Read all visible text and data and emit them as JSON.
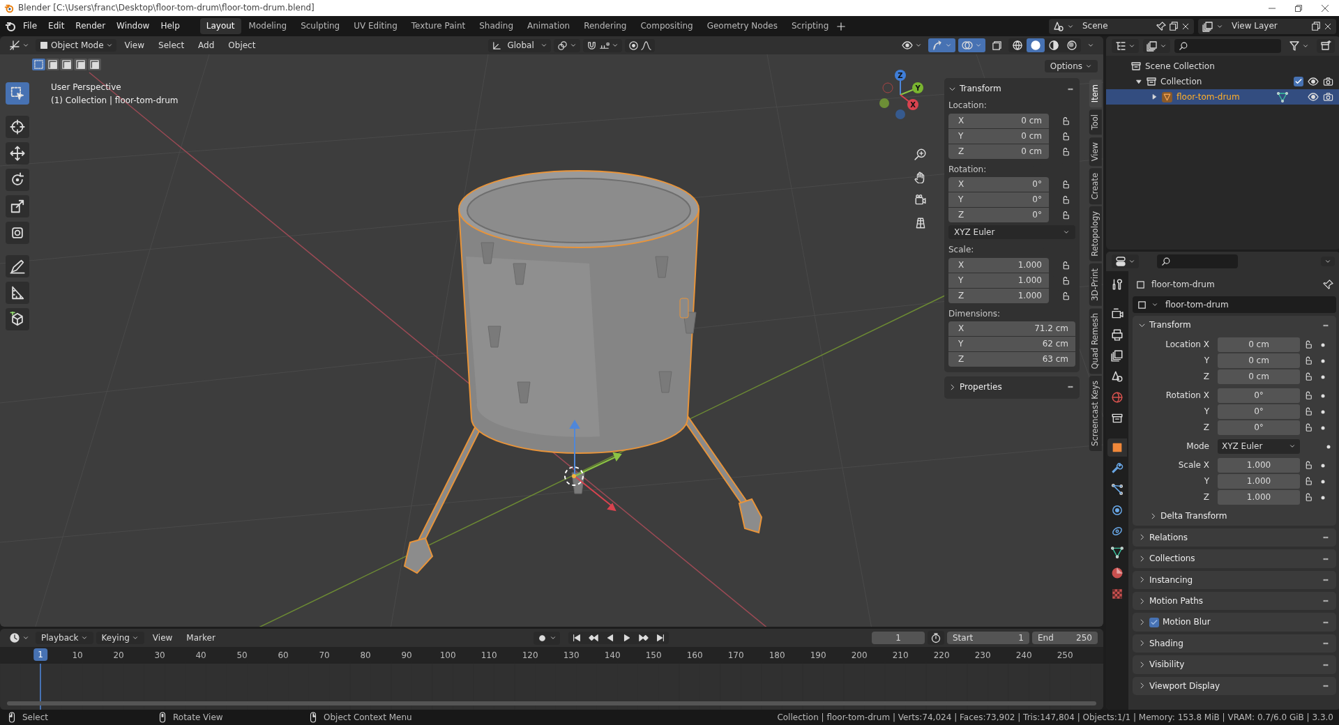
{
  "window": {
    "title": "Blender [C:\\Users\\franc\\Desktop\\floor-tom-drum\\floor-tom-drum.blend]"
  },
  "menu": [
    "File",
    "Edit",
    "Render",
    "Window",
    "Help"
  ],
  "workspaces": [
    {
      "label": "Layout",
      "selected": true
    },
    {
      "label": "Modeling",
      "selected": false
    },
    {
      "label": "Sculpting",
      "selected": false
    },
    {
      "label": "UV Editing",
      "selected": false
    },
    {
      "label": "Texture Paint",
      "selected": false
    },
    {
      "label": "Shading",
      "selected": false
    },
    {
      "label": "Animation",
      "selected": false
    },
    {
      "label": "Rendering",
      "selected": false
    },
    {
      "label": "Compositing",
      "selected": false
    },
    {
      "label": "Geometry Nodes",
      "selected": false
    },
    {
      "label": "Scripting",
      "selected": false
    }
  ],
  "scene": {
    "name": "Scene"
  },
  "view_layer": {
    "name": "View Layer"
  },
  "viewport_header": {
    "mode": "Object Mode",
    "menus": [
      "View",
      "Select",
      "Add",
      "Object"
    ],
    "orientation": "Global",
    "gizmos_on": true,
    "overlays_on": true,
    "shading": [
      {
        "kind": "wireframe",
        "selected": false
      },
      {
        "kind": "solid",
        "selected": true
      },
      {
        "kind": "material",
        "selected": false
      },
      {
        "kind": "rendered",
        "selected": false
      }
    ],
    "options": "Options"
  },
  "select_modes": [
    {
      "selected": true
    },
    {
      "selected": false
    },
    {
      "selected": false
    },
    {
      "selected": false
    },
    {
      "selected": false
    }
  ],
  "tools": [
    {
      "kind": "select",
      "selected": true
    },
    {
      "kind": "cursor",
      "selected": false
    },
    {
      "kind": "move",
      "selected": false
    },
    {
      "kind": "rotate",
      "selected": false
    },
    {
      "kind": "scale",
      "selected": false
    },
    {
      "kind": "transform",
      "selected": false
    },
    {
      "kind": "annotate",
      "selected": false
    },
    {
      "kind": "measure",
      "selected": false
    },
    {
      "kind": "add_cube",
      "selected": false
    }
  ],
  "viewport_info": [
    "User Perspective",
    "(1) Collection | floor-tom-drum"
  ],
  "gizmo_axes": [
    "X",
    "Y",
    "Z"
  ],
  "sidebar": {
    "transform": {
      "title": "Transform",
      "expanded": true,
      "groups": [
        {
          "label": "Location:",
          "lockable": true,
          "fields": [
            {
              "axis": "X",
              "value": "0 cm"
            },
            {
              "axis": "Y",
              "value": "0 cm"
            },
            {
              "axis": "Z",
              "value": "0 cm"
            }
          ]
        },
        {
          "label": "Rotation:",
          "lockable": true,
          "fields": [
            {
              "axis": "X",
              "value": "0°"
            },
            {
              "axis": "Y",
              "value": "0°"
            },
            {
              "axis": "Z",
              "value": "0°"
            }
          ],
          "mode": "XYZ Euler"
        },
        {
          "label": "Scale:",
          "lockable": true,
          "fields": [
            {
              "axis": "X",
              "value": "1.000"
            },
            {
              "axis": "Y",
              "value": "1.000"
            },
            {
              "axis": "Z",
              "value": "1.000"
            }
          ]
        },
        {
          "label": "Dimensions:",
          "lockable": false,
          "fields": [
            {
              "axis": "X",
              "value": "71.2 cm"
            },
            {
              "axis": "Y",
              "value": "62 cm"
            },
            {
              "axis": "Z",
              "value": "63 cm"
            }
          ]
        }
      ]
    },
    "properties": {
      "title": "Properties",
      "expanded": false
    },
    "tabs": [
      {
        "label": "Item",
        "selected": true
      },
      {
        "label": "Tool",
        "selected": false
      },
      {
        "label": "View",
        "selected": false
      },
      {
        "label": "Create",
        "selected": false
      },
      {
        "label": "Retopology",
        "selected": false
      },
      {
        "label": "3D-Print",
        "selected": false
      },
      {
        "label": "Quad Remesh",
        "selected": false
      },
      {
        "label": "Screencast Keys",
        "selected": false
      }
    ]
  },
  "outliner": {
    "tree": [
      {
        "label": "Scene Collection",
        "kind": "scene_collection",
        "selected": false,
        "children": [
          {
            "label": "Collection",
            "kind": "collection",
            "selected": false,
            "expanded": true,
            "included": true,
            "children": [
              {
                "label": "floor-tom-drum",
                "kind": "mesh_object",
                "selected": true,
                "expanded": false
              }
            ]
          }
        ]
      }
    ]
  },
  "properties": {
    "tabs": [
      {
        "kind": "tool",
        "selected": false
      },
      {
        "kind": "render",
        "selected": false
      },
      {
        "kind": "output",
        "selected": false
      },
      {
        "kind": "view_layer",
        "selected": false
      },
      {
        "kind": "scene",
        "selected": false
      },
      {
        "kind": "world",
        "selected": false
      },
      {
        "kind": "collection",
        "selected": false
      },
      {
        "kind": "object",
        "selected": true
      },
      {
        "kind": "modifiers",
        "selected": false
      },
      {
        "kind": "particles",
        "selected": false
      },
      {
        "kind": "physics",
        "selected": false
      },
      {
        "kind": "constraints",
        "selected": false
      },
      {
        "kind": "data",
        "selected": false
      },
      {
        "kind": "material",
        "selected": false
      },
      {
        "kind": "texture",
        "selected": false
      }
    ],
    "object_name": "floor-tom-drum",
    "data_name": "floor-tom-drum",
    "transform": {
      "title": "Transform",
      "expanded": true,
      "groups": [
        [
          {
            "label": "Location X",
            "value": "0 cm",
            "kind": "number"
          },
          {
            "label": "Y",
            "value": "0 cm",
            "kind": "number"
          },
          {
            "label": "Z",
            "value": "0 cm",
            "kind": "number"
          }
        ],
        [
          {
            "label": "Rotation X",
            "value": "0°",
            "kind": "number"
          },
          {
            "label": "Y",
            "value": "0°",
            "kind": "number"
          },
          {
            "label": "Z",
            "value": "0°",
            "kind": "number"
          }
        ],
        [
          {
            "label": "Mode",
            "value": "XYZ Euler",
            "kind": "select"
          }
        ],
        [
          {
            "label": "Scale X",
            "value": "1.000",
            "kind": "number"
          },
          {
            "label": "Y",
            "value": "1.000",
            "kind": "number"
          },
          {
            "label": "Z",
            "value": "1.000",
            "kind": "number"
          }
        ]
      ],
      "subpanels": [
        {
          "title": "Delta Transform",
          "expanded": false
        }
      ]
    },
    "panels": [
      {
        "title": "Relations",
        "expanded": false
      },
      {
        "title": "Collections",
        "expanded": false
      },
      {
        "title": "Instancing",
        "expanded": false
      },
      {
        "title": "Motion Paths",
        "expanded": false
      },
      {
        "title": "Motion Blur",
        "expanded": false,
        "checked": true
      },
      {
        "title": "Shading",
        "expanded": false
      },
      {
        "title": "Visibility",
        "expanded": false
      },
      {
        "title": "Viewport Display",
        "expanded": false
      }
    ]
  },
  "timeline": {
    "menus": [
      "Playback",
      "Keying",
      "View",
      "Marker"
    ],
    "current_frame": "1",
    "start": {
      "label": "Start",
      "value": "1"
    },
    "end": {
      "label": "End",
      "value": "250"
    },
    "playhead": "1",
    "ruler": [
      "10",
      "20",
      "30",
      "40",
      "50",
      "60",
      "70",
      "80",
      "90",
      "100",
      "110",
      "120",
      "130",
      "140",
      "150",
      "160",
      "170",
      "180",
      "190",
      "200",
      "210",
      "220",
      "230",
      "240",
      "250"
    ]
  },
  "status_bar": {
    "hints": [
      "Select",
      "Rotate View",
      "Object Context Menu"
    ],
    "stats": "Collection | floor-tom-drum | Verts:74,024 | Faces:73,902 | Tris:147,804 | Objects:1/1 | Memory: 153.8 MiB | VRAM: 0.7/6.0 GiB | 3.3.0"
  }
}
